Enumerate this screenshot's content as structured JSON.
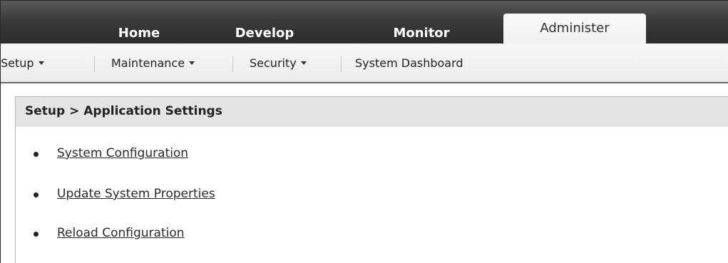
{
  "topnav": {
    "tabs": [
      {
        "label": "Home",
        "active": false
      },
      {
        "label": "Develop",
        "active": false
      },
      {
        "label": "Monitor",
        "active": false
      },
      {
        "label": "Administer",
        "active": true
      }
    ]
  },
  "subnav": {
    "items": [
      {
        "label": "Setup",
        "has_dropdown": true
      },
      {
        "label": "Maintenance",
        "has_dropdown": true
      },
      {
        "label": "Security",
        "has_dropdown": true
      },
      {
        "label": "System Dashboard",
        "has_dropdown": false
      }
    ]
  },
  "breadcrumb": {
    "text": "Setup > Application Settings"
  },
  "links": [
    {
      "label": "System Configuration"
    },
    {
      "label": "Update System Properties"
    },
    {
      "label": "Reload Configuration"
    }
  ],
  "colors": {
    "topnav_dark": "#2c2c2c",
    "active_tab": "#f1f1f1",
    "crumb_bg": "#e4e4e4",
    "link": "#2a2a2a"
  }
}
